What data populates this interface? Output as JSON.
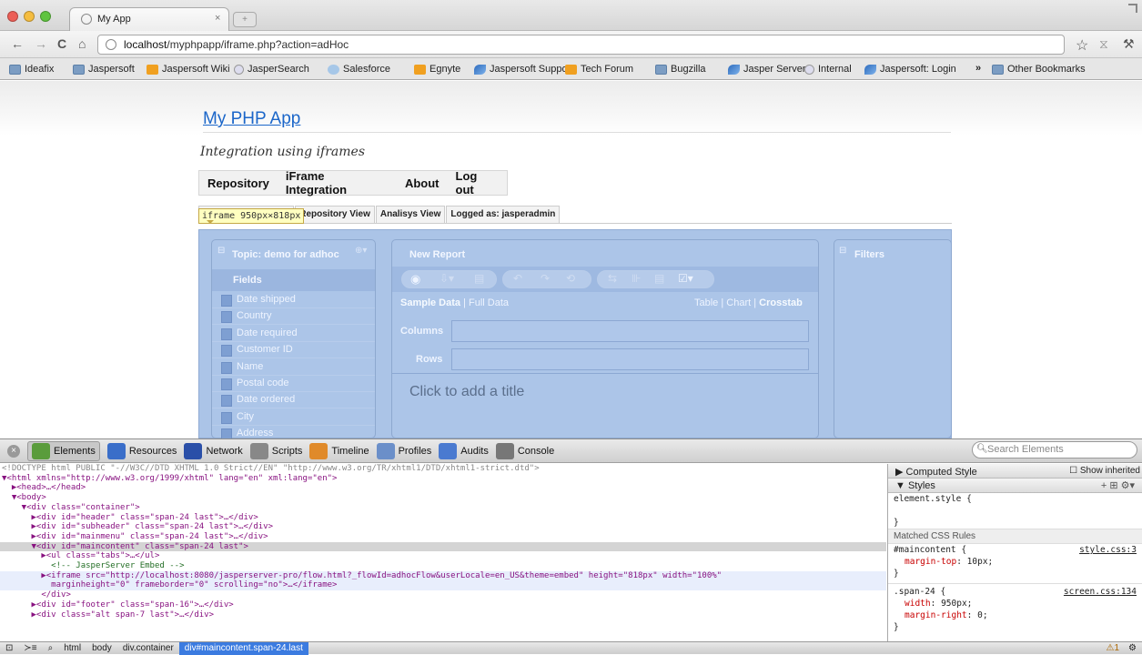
{
  "browser": {
    "tab_title": "My App",
    "tab_close": "×",
    "url_host": "localhost",
    "url_path": "/myphpapp/iframe.php?action=adHoc",
    "bookmarks": [
      "Ideafix",
      "Jaspersoft",
      "Jaspersoft Wiki",
      "JasperSearch",
      "Salesforce",
      "Egnyte",
      "Jaspersoft Support",
      "Tech Forum",
      "Bugzilla",
      "Jasper Server",
      "Internal",
      "Jaspersoft: Login"
    ],
    "bookmark_icons": [
      "folder",
      "folder",
      "orange",
      "globe",
      "sf",
      "orange",
      "swoosh",
      "orange",
      "folder",
      "swoosh",
      "globe",
      "swoosh"
    ],
    "other_bookmarks": "Other Bookmarks",
    "overflow": "»"
  },
  "page": {
    "app_title": "My PHP App",
    "subtitle": "Integration using iframes",
    "menu": [
      "Repository",
      "iFrame Integration",
      "About",
      "Log out"
    ],
    "tabs": [
      "rt",
      "Repository View",
      "Analisys View",
      "Logged as: jasperadmin"
    ],
    "tooltip": "iframe 950px×818px"
  },
  "adhoc": {
    "topic": "Topic: demo for adhoc",
    "fields_header": "Fields",
    "fields": [
      "Date shipped",
      "Country",
      "Date required",
      "Customer ID",
      "Name",
      "Postal code",
      "Date ordered",
      "City",
      "Address"
    ],
    "new_report": "New Report",
    "sample_data": "Sample Data",
    "full_data": "Full Data",
    "sep": "|",
    "view_table": "Table",
    "view_chart": "Chart",
    "view_crosstab": "Crosstab",
    "columns_label": "Columns",
    "rows_label": "Rows",
    "title_placeholder": "Click to add a title",
    "filters": "Filters"
  },
  "devtools": {
    "toolbar": [
      "Elements",
      "Resources",
      "Network",
      "Scripts",
      "Timeline",
      "Profiles",
      "Audits",
      "Console"
    ],
    "search_placeholder": "Search Elements",
    "dom": [
      "<!DOCTYPE html PUBLIC \"-//W3C//DTD XHTML 1.0 Strict//EN\" \"http://www.w3.org/TR/xhtml1/DTD/xhtml1-strict.dtd\">",
      "▼<html xmlns=\"http://www.w3.org/1999/xhtml\" lang=\"en\" xml:lang=\"en\">",
      "  ▶<head>…</head>",
      "  ▼<body>",
      "    ▼<div class=\"container\">",
      "      ▶<div id=\"header\" class=\"span-24 last\">…</div>",
      "      ▶<div id=\"subheader\" class=\"span-24 last\">…</div>",
      "      ▶<div id=\"mainmenu\" class=\"span-24 last\">…</div>",
      "      ▼<div id=\"maincontent\" class=\"span-24 last\">",
      "        ▶<ul class=\"tabs\">…</ul>",
      "          <!-- JasperServer Embed -->",
      "        ▶<iframe src=\"http://localhost:8080/jasperserver-pro/flow.html?_flowId=adhocFlow&userLocale=en_US&theme=embed\" height=\"818px\" width=\"100%\"",
      "          marginheight=\"0\" frameborder=\"0\" scrolling=\"no\">…</iframe>",
      "        </div>",
      "      ▶<div id=\"footer\" class=\"span-16\">…</div>",
      "      ▶<div class=\"alt span-7 last\">…</div>"
    ],
    "computed_style": "Computed Style",
    "show_inherited": "Show inherited",
    "styles": "Styles",
    "element_style": "element.style {",
    "close_brace": "}",
    "matched": "Matched CSS Rules",
    "rule1_sel": "#maincontent {",
    "rule1_src": "style.css:3",
    "rule1_p1": "margin-top",
    "rule1_v1": "10px;",
    "rule2_sel": ".span-24 {",
    "rule2_src": "screen.css:134",
    "rule2_p1": "width",
    "rule2_v1": "950px;",
    "rule2_p2": "margin-right",
    "rule2_v2": "0;",
    "breadcrumbs": [
      "html",
      "body",
      "div.container"
    ],
    "breadcrumb_selected": "div#maincontent.span-24.last",
    "warnings": "1"
  }
}
